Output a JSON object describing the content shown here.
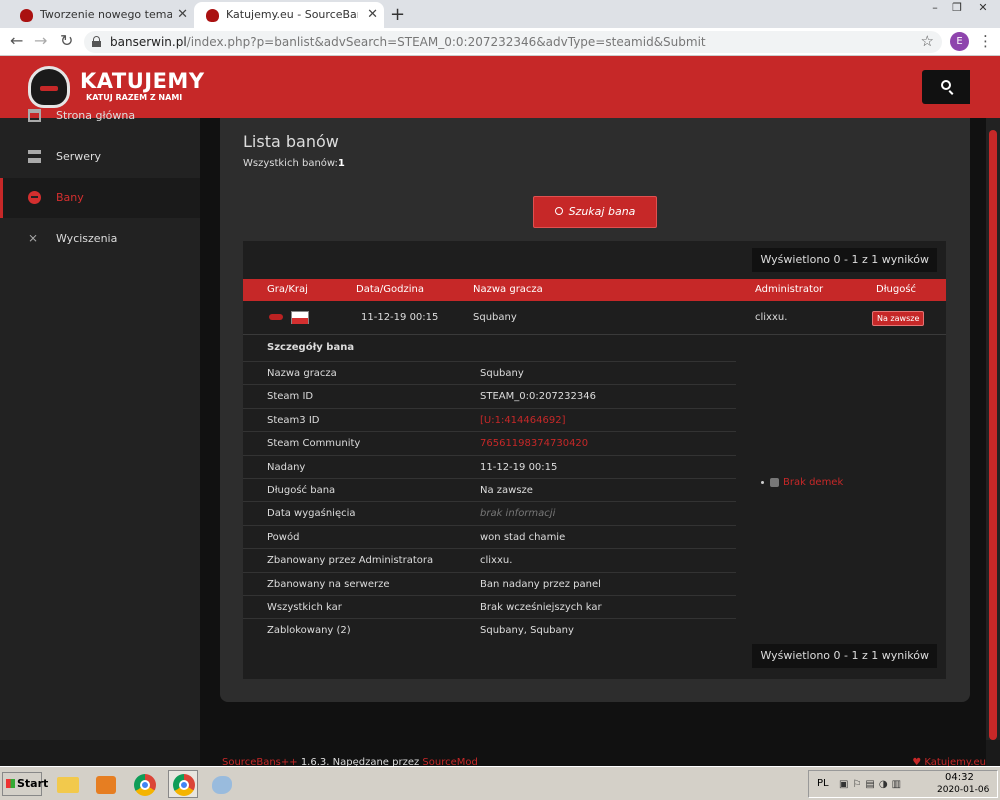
{
  "browser": {
    "tabs": [
      {
        "title": "Tworzenie nowego tematu - Katujemy"
      },
      {
        "title": "Katujemy.eu - SourceBans"
      }
    ],
    "new_tab": "+",
    "url_host": "banserwin.pl",
    "url_path": "/index.php?p=banlist&advSearch=STEAM_0:0:207232346&advType=steamid&Submit",
    "profile_initial": "E",
    "window_controls": {
      "minimize": "–",
      "restore": "❐",
      "close": "✕"
    }
  },
  "site": {
    "logo_title": "KATUJEMY",
    "logo_subtitle": "KATUJ RAZEM Z NAMI",
    "brand_color": "#c62828"
  },
  "sidebar": {
    "items": [
      {
        "label": "Strona główna",
        "icon": "home-icon"
      },
      {
        "label": "Serwery",
        "icon": "server-icon"
      },
      {
        "label": "Bany",
        "icon": "ban-icon",
        "active": true
      },
      {
        "label": "Wyciszenia",
        "icon": "mute-icon"
      }
    ]
  },
  "main": {
    "title": "Lista banów",
    "count_label": "Wszystkich banów:",
    "count_value": "1",
    "search_button": "Szukaj bana",
    "showing": "Wyświetlono 0 - 1 z 1 wyników",
    "table": {
      "headers": [
        "Gra/Kraj",
        "Data/Godzina",
        "Nazwa gracza",
        "Administrator",
        "Długość"
      ],
      "row": {
        "date": "11-12-19 00:15",
        "player": "Squbany",
        "admin": "clixxu.",
        "length": "Na zawsze"
      }
    },
    "details": {
      "title": "Szczegóły bana",
      "rows": [
        {
          "label": "Nazwa gracza",
          "value": "Squbany"
        },
        {
          "label": "Steam ID",
          "value": "STEAM_0:0:207232346"
        },
        {
          "label": "Steam3 ID",
          "value": "[U:1:414464692]"
        },
        {
          "label": "Steam Community",
          "value": "76561198374730420"
        },
        {
          "label": "Nadany",
          "value": "11-12-19 00:15"
        },
        {
          "label": "Długość bana",
          "value": "Na zawsze"
        },
        {
          "label": "Data wygaśnięcia",
          "value": "brak informacji"
        },
        {
          "label": "Powód",
          "value": "won stad chamie"
        },
        {
          "label": "Zbanowany przez Administratora",
          "value": "clixxu."
        },
        {
          "label": "Zbanowany na serwerze",
          "value": "Ban nadany przez panel"
        },
        {
          "label": "Wszystkich kar",
          "value": "Brak wcześniejszych kar"
        },
        {
          "label": "Zablokowany (2)",
          "value": "Squbany, Squbany"
        }
      ],
      "demos": "Brak demek"
    }
  },
  "footer": {
    "left_link": "SourceBans++",
    "version_text": " 1.6.3. Napędzane przez ",
    "sourcemod": "SourceMod",
    "right": "♥ Katujemy.eu"
  },
  "taskbar": {
    "start": "Start",
    "lang": "PL",
    "time": "04:32",
    "date": "2020-01-06"
  }
}
